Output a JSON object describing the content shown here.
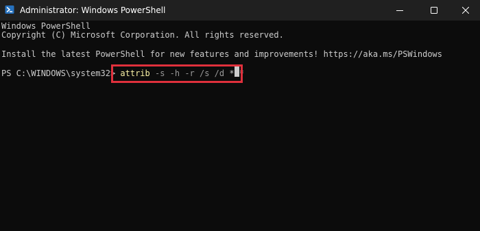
{
  "window": {
    "title": "Administrator: Windows PowerShell",
    "icon": "powershell-icon",
    "controls": [
      "minimize-icon",
      "maximize-icon",
      "close-icon"
    ]
  },
  "console": {
    "lines": [
      "Windows PowerShell",
      "Copyright (C) Microsoft Corporation. All rights reserved.",
      "Install the latest PowerShell for new features and improvements! https://aka.ms/PSWindows"
    ],
    "prompt": "PS C:\\WINDOWS\\system32> ",
    "command": {
      "name": "attrib",
      "args": " -s -h -r /s /d ",
      "target": "*.*"
    }
  },
  "colors": {
    "background": "#0c0c0c",
    "titlebar": "#202020",
    "text": "#cccccc",
    "command": "#f9f1a5",
    "parameters": "#9a9a9a",
    "highlight": "#e0303c"
  }
}
